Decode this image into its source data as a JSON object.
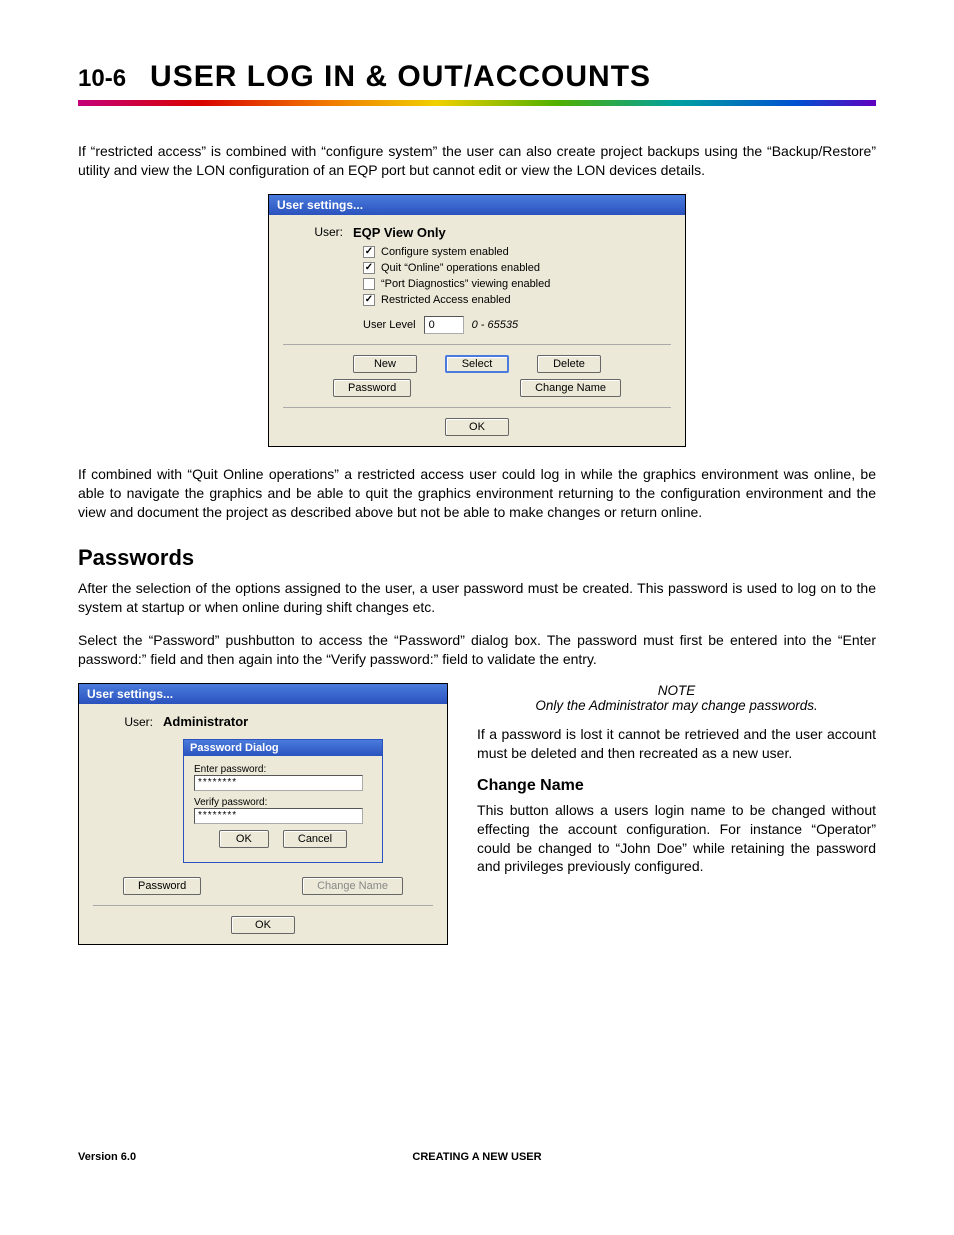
{
  "header": {
    "page_num": "10-6",
    "title": "USER LOG IN & OUT/ACCOUNTS"
  },
  "para1": "If “restricted access” is combined with “configure system” the user can also create project backups using the “Backup/Restore” utility and view the LON configuration of an EQP port but cannot edit or view the LON devices details.",
  "shot1": {
    "title": "User settings...",
    "user_label": "User:",
    "user_value": "EQP View Only",
    "cb1": "Configure system enabled",
    "cb2": "Quit “Online” operations enabled",
    "cb3": "“Port Diagnostics” viewing enabled",
    "cb4": "Restricted Access enabled",
    "userlevel_label": "User Level",
    "userlevel_value": "0",
    "userlevel_range": "0 - 65535",
    "btn_new": "New",
    "btn_select": "Select",
    "btn_delete": "Delete",
    "btn_password": "Password",
    "btn_changename": "Change Name",
    "btn_ok": "OK"
  },
  "para2": "If combined with “Quit Online operations” a restricted access user could log in while the graphics environment was online, be able to navigate the graphics and be able to quit the graphics environment returning to the configuration environment and the view and document the project as described above but not be able to make changes or return online.",
  "passwords_heading": "Passwords",
  "para3": "After the selection of the options assigned to the user, a user password must be created.  This password is used to log on to the system at startup or when online during shift changes etc.",
  "para4": "Select the “Password” pushbutton to access the “Password” dialog box.  The password must first be entered into the “Enter password:” field and then again into the “Verify password:” field to validate the entry.",
  "shot2": {
    "title": "User settings...",
    "user_label": "User:",
    "user_value": "Administrator",
    "pwd_title": "Password Dialog",
    "enter_pwd": "Enter password:",
    "verify_pwd": "Verify password:",
    "pwd_masked": "********",
    "btn_ok": "OK",
    "btn_cancel": "Cancel",
    "btn_password": "Password",
    "btn_changename": "Change Name"
  },
  "note_label": "NOTE",
  "note_text": "Only the Administrator may change passwords.",
  "para5": "If a password is lost it cannot be retrieved and the user account must be deleted and then recreated as a new user.",
  "changename_heading": "Change Name",
  "para6": "This button allows a users login name to be changed without effecting the account configuration.  For instance “Operator” could be changed to “John Doe” while retaining the password and privileges previously configured.",
  "footer": {
    "version": "Version 6.0",
    "section": "CREATING A NEW USER"
  }
}
